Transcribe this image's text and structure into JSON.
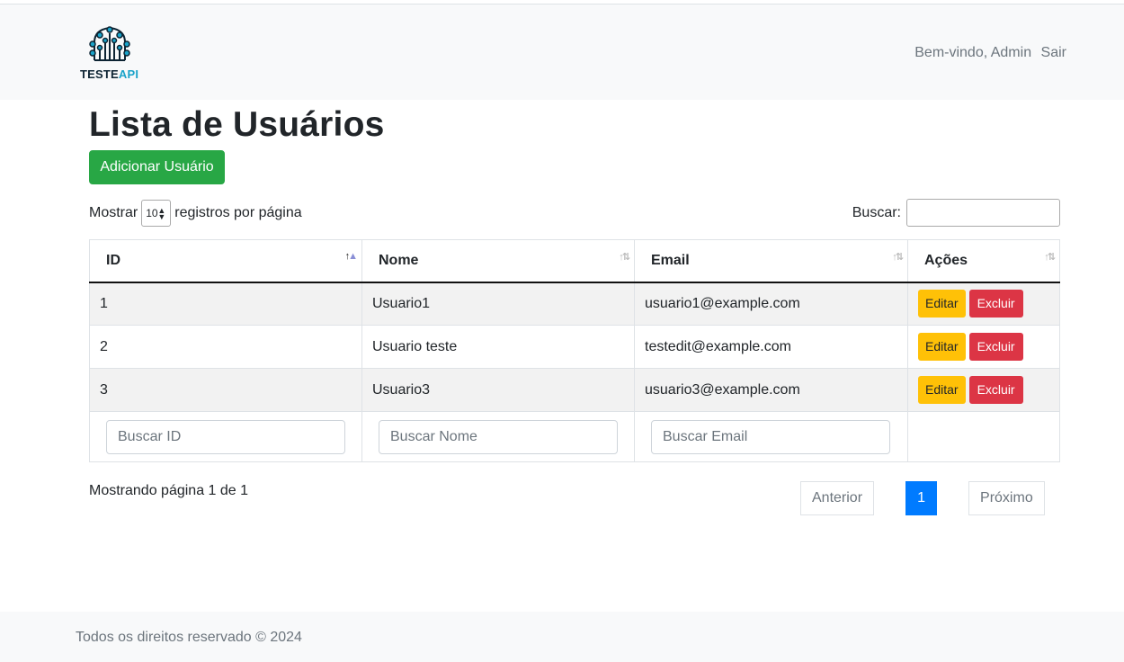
{
  "navbar": {
    "logo_text_main": "TESTE",
    "logo_text_accent": "API",
    "welcome": "Bem-vindo, Admin",
    "logout": "Sair"
  },
  "main": {
    "title": "Lista de Usuários",
    "add_button": "Adicionar Usuário",
    "length": {
      "prefix": "Mostrar",
      "value": "10",
      "suffix": "registros por página"
    },
    "search_label": "Buscar:",
    "table": {
      "columns": [
        "ID",
        "Nome",
        "Email",
        "Ações"
      ],
      "rows": [
        {
          "id": "1",
          "nome": "Usuario1",
          "email": "usuario1@example.com"
        },
        {
          "id": "2",
          "nome": "Usuario teste",
          "email": "testedit@example.com"
        },
        {
          "id": "3",
          "nome": "Usuario3",
          "email": "usuario3@example.com"
        }
      ],
      "edit_label": "Editar",
      "delete_label": "Excluir",
      "filters": {
        "id_placeholder": "Buscar ID",
        "nome_placeholder": "Buscar Nome",
        "email_placeholder": "Buscar Email"
      }
    },
    "info": "Mostrando página 1 de 1",
    "pagination": {
      "previous": "Anterior",
      "current": "1",
      "next": "Próximo"
    }
  },
  "footer": {
    "text": "Todos os direitos reservado © 2024"
  },
  "colors": {
    "success": "#28a745",
    "warning": "#ffc107",
    "danger": "#dc3545",
    "primary": "#007bff",
    "navbar_bg": "#f8f9fa"
  }
}
